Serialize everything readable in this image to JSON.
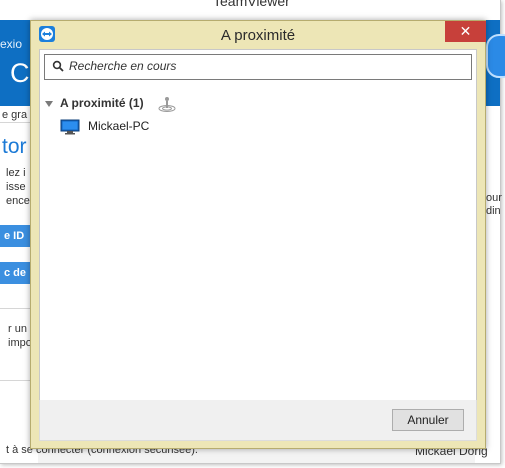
{
  "background_window": {
    "title": "TeamViewer",
    "subtab_fragment": "exio",
    "big_fragment": "Co",
    "side_fragments": [
      "e gra",
      "tor",
      "lez i",
      "isse",
      "ence.",
      "r un",
      "impo"
    ],
    "button_fragments": [
      "e ID",
      "c de"
    ],
    "right_fragments": [
      "our",
      "din"
    ],
    "footer_left": "t à se connecter (connexion sécurisée).",
    "footer_right": "Mickael Dorig"
  },
  "dialog": {
    "title": "A proximité",
    "close_label": "✕",
    "search": {
      "placeholder": "Recherche en cours",
      "value": ""
    },
    "group": {
      "label": "A proximité (1)"
    },
    "devices": [
      {
        "label": "Mickael-PC",
        "icon": "monitor-icon"
      }
    ],
    "cancel_label": "Annuler"
  },
  "colors": {
    "dialog_frame": "#ede6b6",
    "close_button": "#c7403a",
    "teamviewer_blue": "#0e6fc3"
  }
}
